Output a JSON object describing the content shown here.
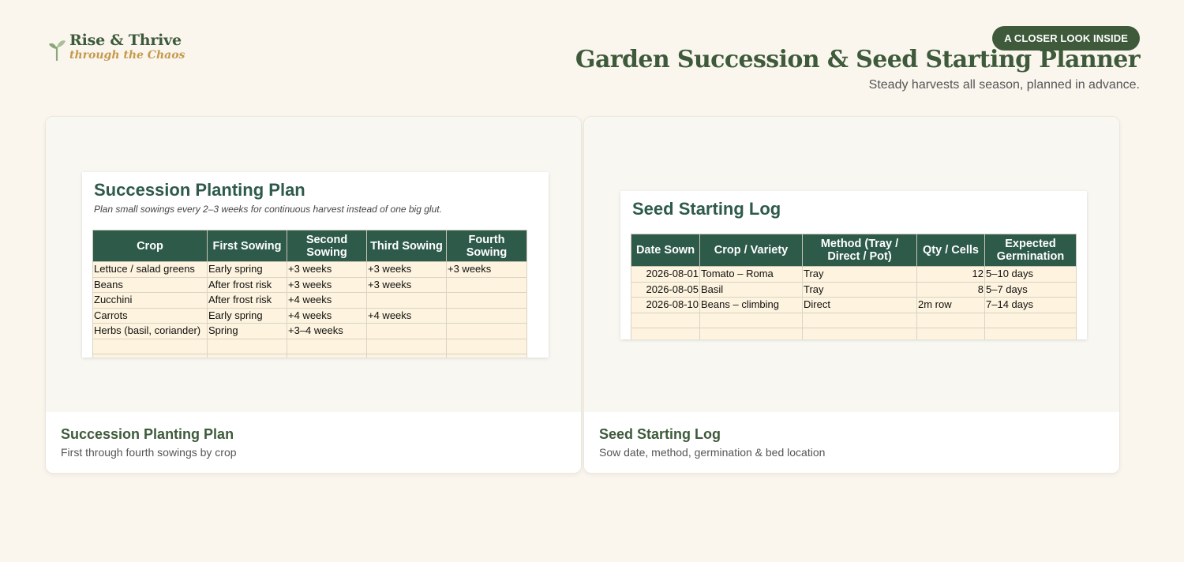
{
  "brand": {
    "name": "Rise & Thrive",
    "tagline": "through the Chaos"
  },
  "header": {
    "badge": "A CLOSER LOOK INSIDE",
    "title": "Garden Succession & Seed Starting Planner",
    "subtitle": "Steady harvests all season, planned in advance."
  },
  "cards": [
    {
      "title": "Succession Planting Plan",
      "description": "First through fourth sowings by crop",
      "sheet": {
        "title": "Succession Planting Plan",
        "note": "Plan small sowings every 2–3 weeks for continuous harvest instead of one big glut.",
        "columns": [
          "Crop",
          "First Sowing",
          "Second Sowing",
          "Third Sowing",
          "Fourth Sowing"
        ],
        "rows": [
          [
            "Lettuce / salad greens",
            "Early spring",
            "+3 weeks",
            "+3 weeks",
            "+3 weeks"
          ],
          [
            "Beans",
            "After frost risk",
            "+3 weeks",
            "+3 weeks",
            ""
          ],
          [
            "Zucchini",
            "After frost risk",
            "+4 weeks",
            "",
            ""
          ],
          [
            "Carrots",
            "Early spring",
            "+4 weeks",
            "+4 weeks",
            ""
          ],
          [
            "Herbs (basil, coriander)",
            "Spring",
            "+3–4 weeks",
            "",
            ""
          ]
        ]
      }
    },
    {
      "title": "Seed Starting Log",
      "description": "Sow date, method, germination & bed location",
      "sheet": {
        "title": "Seed Starting Log",
        "columns": [
          "Date Sown",
          "Crop / Variety",
          "Method (Tray / Direct / Pot)",
          "Qty / Cells",
          "Expected Germination"
        ],
        "rows": [
          [
            "2026-08-01",
            "Tomato – Roma",
            "Tray",
            "12",
            "5–10 days"
          ],
          [
            "2026-08-05",
            "Basil",
            "Tray",
            "8",
            "5–7 days"
          ],
          [
            "2026-08-10",
            "Beans – climbing",
            "Direct",
            "2m row",
            "7–14 days"
          ]
        ]
      }
    }
  ]
}
